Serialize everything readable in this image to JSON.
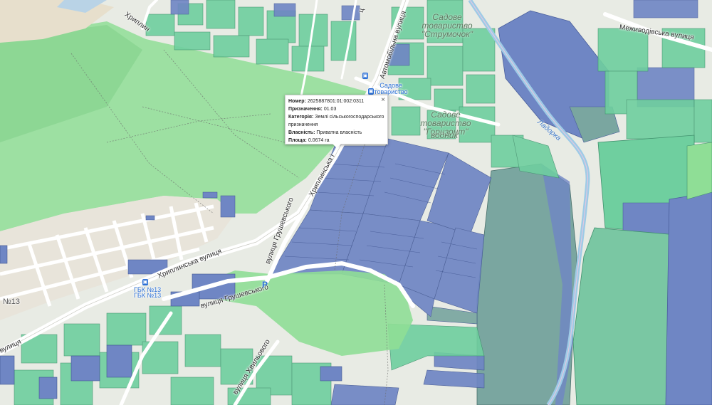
{
  "map": {
    "labels": {
      "hryplynska_street": "Хриплинська вулиця",
      "hryplynska_short": "Хриплинська і",
      "hrushevskoho_street": "вулиця Грушевського",
      "hrushevskoho_vertical": "вулиця Грушевського",
      "avtomobilna_street": "Автомобільна вулиця",
      "mezhyvodivska_street": "Меживодівська вулиця",
      "khvylyovoho_street": "вулиця Хвильового",
      "tsentralna_partial": "ц",
      "vulytsia_left": "вулиця",
      "hryplyn_top": "Хриплин",
      "sadove_area_1": "Садове товариство \"Струмочок\"",
      "sadove_area_2": "Садове товариство",
      "sadove_area_3": "Садове товариство \"Горизонт\"",
      "sadove_area_3_suffix": "водник",
      "stream_label": "Ладорка",
      "number_13": "№13",
      "stop_label_1": "ГБК №13",
      "stop_label_2": "ГБК №13",
      "bus_stop_top": "Садове товариство"
    },
    "icons": {
      "bus_stop": "bus-icon",
      "parking": "parking-icon",
      "parking_glyph": "P",
      "bus_glyph": "▣"
    }
  },
  "popup": {
    "number_label": "Номер:",
    "number_value": "2625887801:01:002:0311",
    "purpose_label": "Призначення:",
    "purpose_value": "01.03",
    "category_label": "Категорія:",
    "category_value": "Землі сільськогосподарського призначення",
    "ownership_label": "Власність:",
    "ownership_value": "Приватна власність",
    "area_label": "Площа:",
    "area_value": "0.0674 га",
    "close_glyph": "×"
  },
  "colors": {
    "parcel_green": "#6fcf9f",
    "parcel_teal": "#7aa6a0",
    "parcel_blue": "#6f86c4",
    "meadow_green": "#8fde96",
    "road": "#ffffff",
    "stream": "#9ecbe6"
  }
}
